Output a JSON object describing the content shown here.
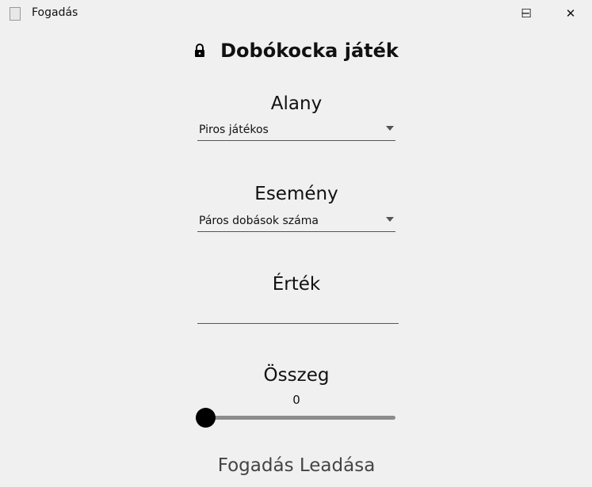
{
  "window": {
    "title": "Fogadás",
    "minimize": "─",
    "maximize": "☐",
    "close": "✕"
  },
  "header": {
    "title": "Dobókocka játék",
    "icon": "lock-icon"
  },
  "subject": {
    "label": "Alany",
    "value": "Piros játékos"
  },
  "event": {
    "label": "Esemény",
    "value": "Páros dobások száma"
  },
  "value": {
    "label": "Érték",
    "value": ""
  },
  "amount": {
    "label": "Összeg",
    "value": "0",
    "fraction": 0
  },
  "submit": {
    "label": "Fogadás Leadása"
  }
}
